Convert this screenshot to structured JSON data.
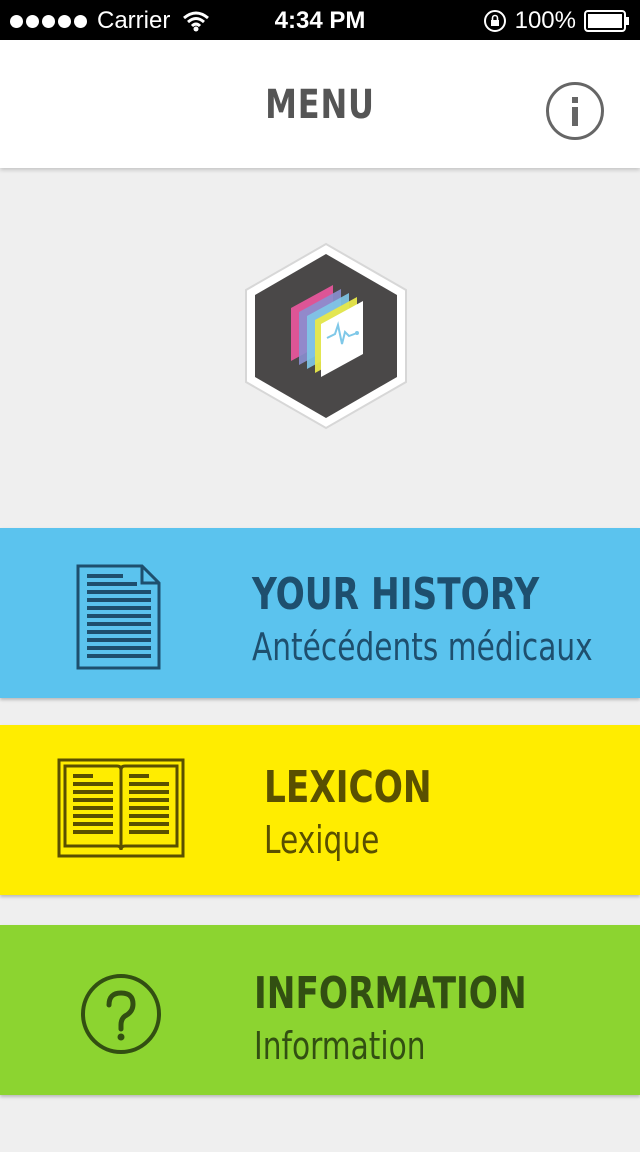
{
  "status_bar": {
    "carrier": "Carrier",
    "time": "4:34 PM",
    "battery": "100%"
  },
  "header": {
    "title": "MENU",
    "info_icon": "info-icon"
  },
  "logo": {
    "icon": "app-logo-hexagon",
    "colors": [
      "#e5569b",
      "#8a8fd0",
      "#7fc8e8",
      "#e8e84a"
    ]
  },
  "menu": [
    {
      "title": "YOUR HISTORY",
      "subtitle": "Antécédents médicaux",
      "icon": "document-icon",
      "color": "#5bc3ee"
    },
    {
      "title": "LEXICON",
      "subtitle": "Lexique",
      "icon": "book-icon",
      "color": "#ffed00"
    },
    {
      "title": "INFORMATION",
      "subtitle": "Information",
      "icon": "question-icon",
      "color": "#8cd430"
    }
  ]
}
